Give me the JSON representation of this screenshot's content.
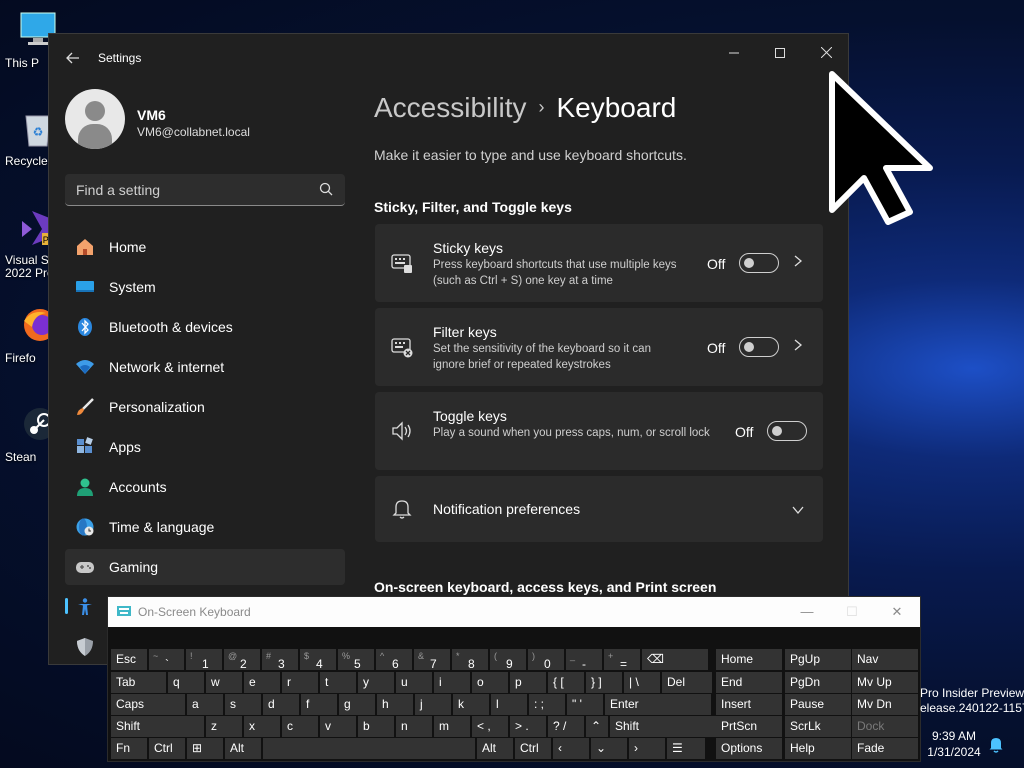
{
  "desktop": {
    "icons": [
      {
        "label": "This P",
        "icon": "this-pc-icon"
      },
      {
        "label": "Recycle",
        "icon": "recycle-bin-icon"
      },
      {
        "label": "Visual St\n2022 Pre",
        "icon": "visual-studio-icon"
      },
      {
        "label": "Firefo",
        "icon": "firefox-icon"
      },
      {
        "label": "Stean",
        "icon": "steam-icon"
      }
    ],
    "watermark_line1": "Pro Insider Preview",
    "watermark_line2": "elease.240122-1157"
  },
  "settings": {
    "title": "Settings",
    "user": {
      "name": "VM6",
      "email": "VM6@collabnet.local"
    },
    "search_placeholder": "Find a setting",
    "nav": [
      {
        "label": "Home",
        "icon": "home-icon"
      },
      {
        "label": "System",
        "icon": "system-icon"
      },
      {
        "label": "Bluetooth & devices",
        "icon": "bluetooth-icon"
      },
      {
        "label": "Network & internet",
        "icon": "wifi-icon"
      },
      {
        "label": "Personalization",
        "icon": "brush-icon"
      },
      {
        "label": "Apps",
        "icon": "apps-icon"
      },
      {
        "label": "Accounts",
        "icon": "accounts-icon"
      },
      {
        "label": "Time & language",
        "icon": "globe-clock-icon"
      },
      {
        "label": "Gaming",
        "icon": "gamepad-icon"
      },
      {
        "label": "",
        "icon": "accessibility-icon"
      },
      {
        "label": "",
        "icon": "shield-icon"
      }
    ],
    "breadcrumb_parent": "Accessibility",
    "breadcrumb_current": "Keyboard",
    "description": "Make it easier to type and use keyboard shortcuts.",
    "section1": "Sticky, Filter, and Toggle keys",
    "section2": "On-screen keyboard, access keys, and Print screen",
    "cards": [
      {
        "title": "Sticky keys",
        "desc": "Press keyboard shortcuts that use multiple keys (such as Ctrl + S) one key at a time",
        "state": "Off",
        "icon": "sticky-keys-icon"
      },
      {
        "title": "Filter keys",
        "desc": "Set the sensitivity of the keyboard so it can ignore brief or repeated keystrokes",
        "state": "Off",
        "icon": "filter-keys-icon"
      },
      {
        "title": "Toggle keys",
        "desc": "Play a sound when you press caps, num, or scroll lock",
        "state": "Off",
        "icon": "speaker-icon"
      }
    ],
    "notification": "Notification preferences"
  },
  "osk": {
    "title": "On-Screen Keyboard",
    "row1": [
      {
        "m": "Esc"
      },
      {
        "s": "~",
        "m": "`"
      },
      {
        "s": "!",
        "m": "1"
      },
      {
        "s": "@",
        "m": "2"
      },
      {
        "s": "#",
        "m": "3"
      },
      {
        "s": "$",
        "m": "4"
      },
      {
        "s": "%",
        "m": "5"
      },
      {
        "s": "^",
        "m": "6"
      },
      {
        "s": "&",
        "m": "7"
      },
      {
        "s": "*",
        "m": "8"
      },
      {
        "s": "(",
        "m": "9"
      },
      {
        "s": ")",
        "m": "0"
      },
      {
        "s": "_",
        "m": "-"
      },
      {
        "s": "+",
        "m": "="
      },
      {
        "m": "⌫"
      }
    ],
    "row2": [
      "Tab",
      "q",
      "w",
      "e",
      "r",
      "t",
      "y",
      "u",
      "i",
      "o",
      "p",
      "{ [",
      "} ]",
      "| \\",
      "Del"
    ],
    "row3": [
      "Caps",
      "a",
      "s",
      "d",
      "f",
      "g",
      "h",
      "j",
      "k",
      "l",
      ": ;",
      "\" '",
      "Enter"
    ],
    "row4": [
      "Shift",
      "z",
      "x",
      "c",
      "v",
      "b",
      "n",
      "m",
      "< ,",
      "> .",
      "? /",
      "⌃",
      "Shift"
    ],
    "row5": [
      "Fn",
      "Ctrl",
      "⊞",
      "Alt",
      "",
      "Alt",
      "Ctrl",
      "‹",
      "⌄",
      "›",
      "☰"
    ],
    "nav_keys": [
      "Home",
      "PgUp",
      "Nav",
      "End",
      "PgDn",
      "Mv Up",
      "Insert",
      "Pause",
      "Mv Dn",
      "PrtScn",
      "ScrLk",
      "Dock",
      "Options",
      "Help",
      "Fade"
    ]
  },
  "taskbar": {
    "time": "9:39 AM",
    "date": "1/31/2024"
  }
}
